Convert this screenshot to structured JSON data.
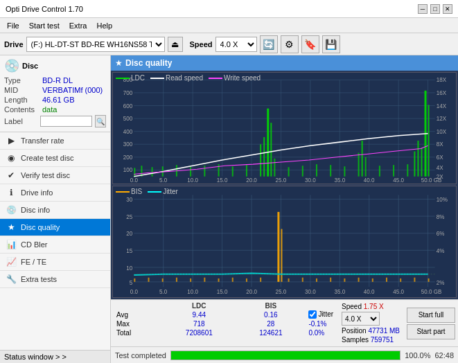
{
  "titlebar": {
    "title": "Opti Drive Control 1.70",
    "min_btn": "─",
    "max_btn": "□",
    "close_btn": "✕"
  },
  "menubar": {
    "items": [
      "File",
      "Start test",
      "Extra",
      "Help"
    ]
  },
  "toolbar": {
    "drive_label": "Drive",
    "drive_value": "(F:)  HL-DT-ST BD-RE  WH16NS58 TST4",
    "speed_label": "Speed",
    "speed_value": "4.0 X"
  },
  "disc": {
    "type_label": "Type",
    "type_value": "BD-R DL",
    "mid_label": "MID",
    "mid_value": "VERBATIMf (000)",
    "length_label": "Length",
    "length_value": "46.61 GB",
    "contents_label": "Contents",
    "contents_value": "data",
    "label_label": "Label",
    "label_value": ""
  },
  "nav_items": [
    {
      "id": "transfer-rate",
      "label": "Transfer rate",
      "icon": "▶"
    },
    {
      "id": "create-test-disc",
      "label": "Create test disc",
      "icon": "◉"
    },
    {
      "id": "verify-test-disc",
      "label": "Verify test disc",
      "icon": "✔"
    },
    {
      "id": "drive-info",
      "label": "Drive info",
      "icon": "ℹ"
    },
    {
      "id": "disc-info",
      "label": "Disc info",
      "icon": "💿"
    },
    {
      "id": "disc-quality",
      "label": "Disc quality",
      "icon": "★",
      "active": true
    },
    {
      "id": "cd-bler",
      "label": "CD Bler",
      "icon": "📊"
    },
    {
      "id": "fe-te",
      "label": "FE / TE",
      "icon": "📈"
    },
    {
      "id": "extra-tests",
      "label": "Extra tests",
      "icon": "🔧"
    }
  ],
  "status_window": "Status window > >",
  "dq_title": "Disc quality",
  "chart1": {
    "legend": [
      {
        "label": "LDC",
        "color": "#00ff00"
      },
      {
        "label": "Read speed",
        "color": "#ffffff"
      },
      {
        "label": "Write speed",
        "color": "#ff44ff"
      }
    ],
    "y_max": 800,
    "y_labels": [
      "800",
      "700",
      "600",
      "500",
      "400",
      "300",
      "200",
      "100"
    ],
    "y_right_labels": [
      "18X",
      "16X",
      "14X",
      "12X",
      "10X",
      "8X",
      "6X",
      "4X",
      "2X"
    ],
    "x_labels": [
      "0.0",
      "5.0",
      "10.0",
      "15.0",
      "20.0",
      "25.0",
      "30.0",
      "35.0",
      "40.0",
      "45.0",
      "50.0 GB"
    ]
  },
  "chart2": {
    "legend": [
      {
        "label": "BIS",
        "color": "#ffaa00"
      },
      {
        "label": "Jitter",
        "color": "#00ffff"
      }
    ],
    "y_max": 30,
    "y_labels": [
      "30",
      "25",
      "20",
      "15",
      "10",
      "5"
    ],
    "y_right_labels": [
      "10%",
      "8%",
      "6%",
      "4%",
      "2%"
    ],
    "x_labels": [
      "0.0",
      "5.0",
      "10.0",
      "15.0",
      "20.0",
      "25.0",
      "30.0",
      "35.0",
      "40.0",
      "45.0",
      "50.0 GB"
    ]
  },
  "stats": {
    "ldc_label": "LDC",
    "bis_label": "BIS",
    "jitter_label": "Jitter",
    "speed_label": "Speed",
    "speed_value": "1.75 X",
    "speed_select": "4.0 X",
    "position_label": "Position",
    "position_value": "47731 MB",
    "samples_label": "Samples",
    "samples_value": "759751",
    "rows": [
      {
        "label": "Avg",
        "ldc": "9.44",
        "bis": "0.16",
        "jitter": "-0.1%"
      },
      {
        "label": "Max",
        "ldc": "718",
        "bis": "28",
        "jitter": "0.0%"
      },
      {
        "label": "Total",
        "ldc": "7208601",
        "bis": "124621",
        "jitter": ""
      }
    ],
    "start_full_label": "Start full",
    "start_part_label": "Start part"
  },
  "progress": {
    "status_text": "Test completed",
    "percent": 100,
    "percent_label": "100.0%",
    "time": "62:48"
  }
}
